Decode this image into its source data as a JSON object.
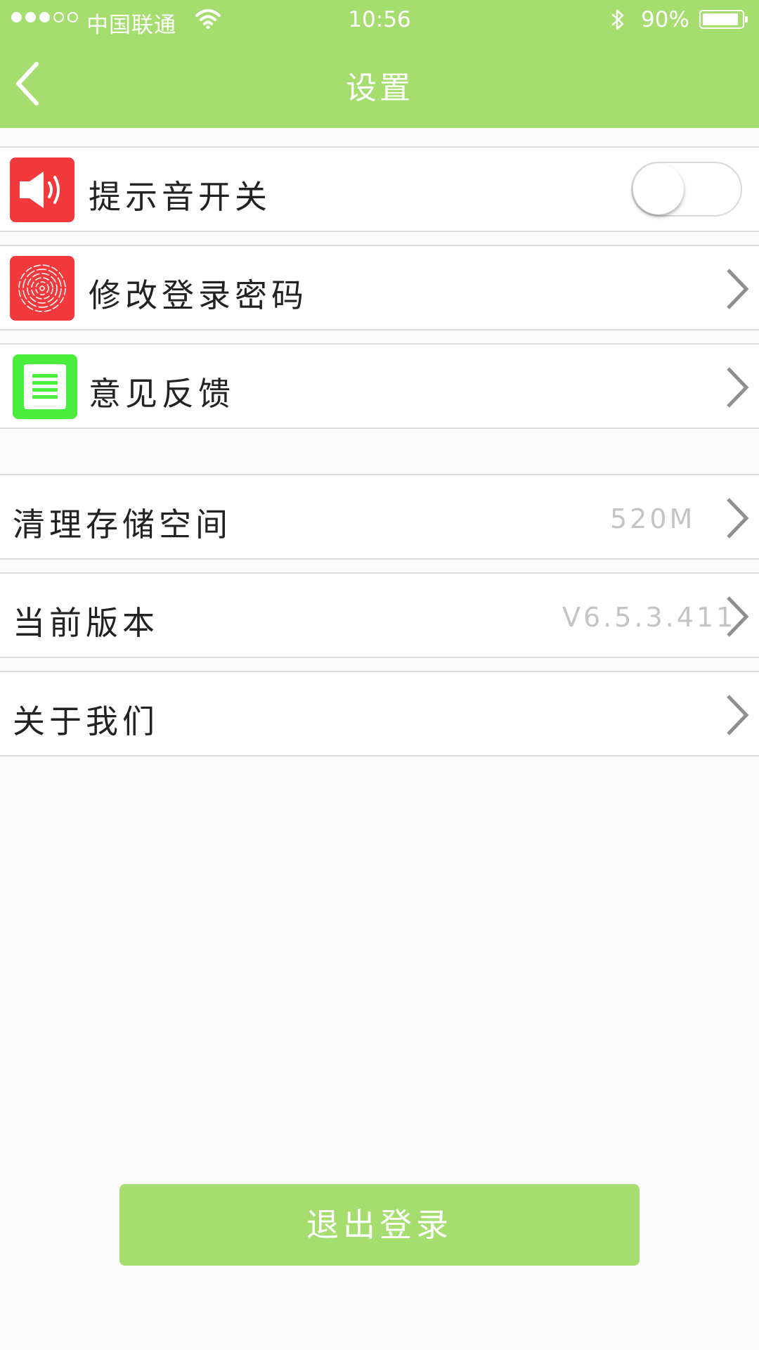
{
  "status_bar": {
    "signal_dots_filled": 3,
    "signal_dots_total": 5,
    "carrier": "中国联通",
    "time": "10:56",
    "battery_percent": "90%",
    "battery_level": 0.9
  },
  "nav": {
    "title": "设置",
    "back_icon": "chevron-left-icon"
  },
  "groups": [
    {
      "rows": [
        {
          "label": "提示音开关",
          "icon": "speaker-icon",
          "icon_color": "#f2393b",
          "control": "toggle",
          "toggle_on": false
        },
        {
          "label": "修改登录密码",
          "icon": "fingerprint-icon",
          "icon_color": "#f2393b",
          "control": "chevron"
        },
        {
          "label": "意见反馈",
          "icon": "document-icon",
          "icon_color": "#49ee3c",
          "control": "chevron"
        }
      ]
    },
    {
      "rows": [
        {
          "label": "清理存储空间",
          "value": "520M",
          "control": "chevron"
        },
        {
          "label": "当前版本",
          "value": "V6.5.3.411",
          "control": "chevron"
        },
        {
          "label": "关于我们",
          "control": "chevron"
        }
      ]
    }
  ],
  "logout": {
    "label": "退出登录"
  },
  "colors": {
    "accent": "#a6dd6f",
    "background": "#fbfbfb",
    "value_text": "#c4c4c4",
    "chevron": "#8f8f8f"
  }
}
